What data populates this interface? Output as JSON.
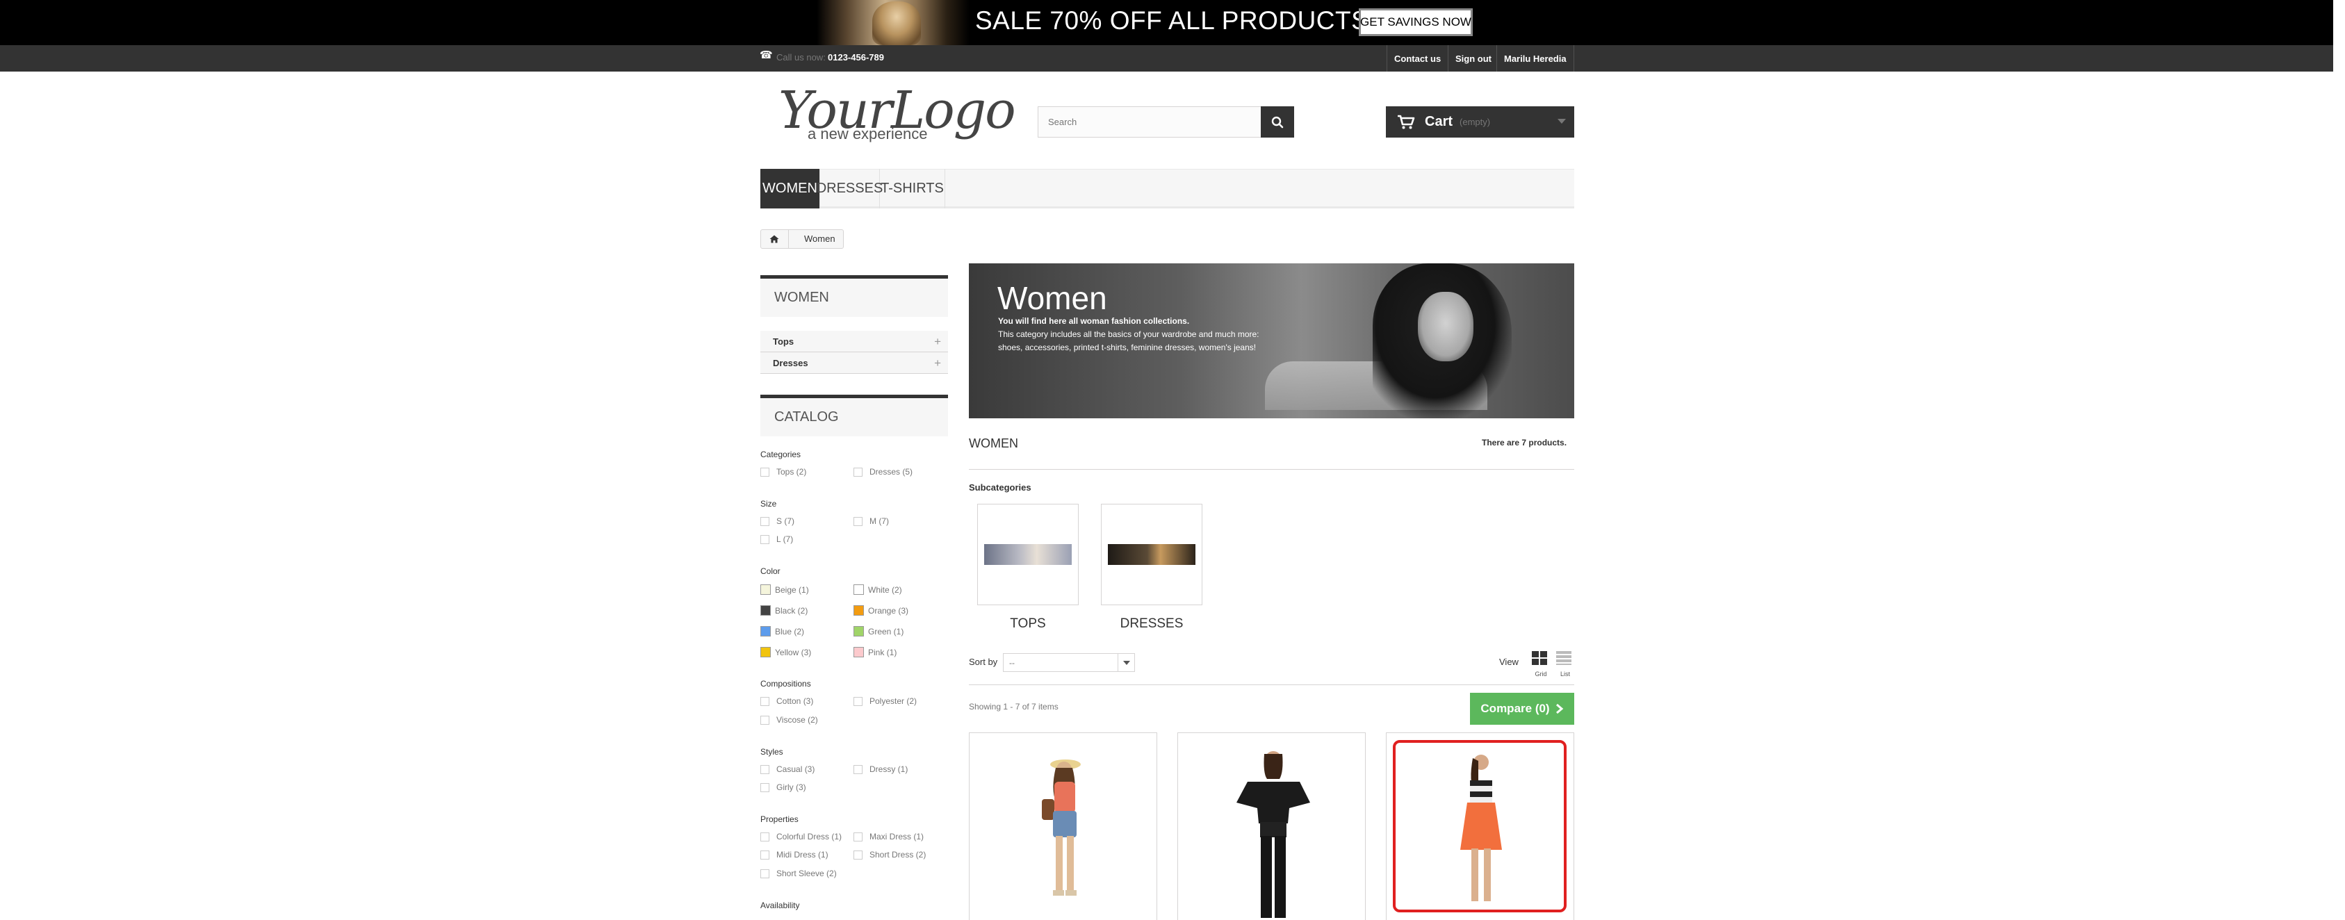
{
  "promo": {
    "text": "SALE 70% OFF ALL PRODUCTS",
    "button": "GET SAVINGS NOW"
  },
  "topnav": {
    "call_label": "Call us now:",
    "phone": "0123-456-789",
    "links": [
      "Contact us",
      "Sign out",
      "Marilu Heredia"
    ]
  },
  "header": {
    "logo": "YourLogo",
    "logo_tagline": "a new experience",
    "search_placeholder": "Search",
    "cart_label": "Cart",
    "cart_status": "(empty)"
  },
  "menu": [
    "WOMEN",
    "DRESSES",
    "T-SHIRTS"
  ],
  "breadcrumb": {
    "current": "Women"
  },
  "sidebar": {
    "women_title": "WOMEN",
    "subcategories": [
      "Tops",
      "Dresses"
    ],
    "catalog_title": "CATALOG",
    "filters": {
      "categories": {
        "title": "Categories",
        "options": [
          "Tops (2)",
          "Dresses (5)"
        ]
      },
      "size": {
        "title": "Size",
        "options": [
          "S (7)",
          "M (7)",
          "L (7)"
        ]
      },
      "color": {
        "title": "Color",
        "options": [
          {
            "label": "Beige (1)",
            "hex": "#f5f5dc"
          },
          {
            "label": "White (2)",
            "hex": "#ffffff"
          },
          {
            "label": "Black (2)",
            "hex": "#434343"
          },
          {
            "label": "Orange (3)",
            "hex": "#f39c11"
          },
          {
            "label": "Blue (2)",
            "hex": "#5d9cec"
          },
          {
            "label": "Green (1)",
            "hex": "#a0d468"
          },
          {
            "label": "Yellow (3)",
            "hex": "#f1c40f"
          },
          {
            "label": "Pink (1)",
            "hex": "#fccacd"
          }
        ]
      },
      "compositions": {
        "title": "Compositions",
        "options": [
          "Cotton (3)",
          "Polyester (2)",
          "Viscose (2)"
        ]
      },
      "styles": {
        "title": "Styles",
        "options": [
          "Casual (3)",
          "Dressy (1)",
          "Girly (3)"
        ]
      },
      "properties": {
        "title": "Properties",
        "options": [
          "Colorful Dress (1)",
          "Maxi Dress (1)",
          "Midi Dress (1)",
          "Short Dress (2)",
          "Short Sleeve (2)"
        ]
      },
      "availability": {
        "title": "Availability"
      }
    }
  },
  "category": {
    "banner_title": "Women",
    "banner_strong": "You will find here all woman fashion collections.",
    "banner_desc1": "This category includes all the basics of your wardrobe and much more:",
    "banner_desc2": "shoes, accessories, printed t-shirts, feminine dresses, women's jeans!",
    "heading": "WOMEN",
    "product_count": "There are 7 products.",
    "subcategories_label": "Subcategories",
    "subcategories": [
      "TOPS",
      "DRESSES"
    ],
    "sort_label": "Sort by",
    "sort_value": "--",
    "view_label": "View",
    "view_grid": "Grid",
    "view_list": "List",
    "showing": "Showing 1 - 7 of 7 items",
    "compare": "Compare (0)"
  },
  "colors": {
    "dark": "#333333",
    "compare_green": "#5cb85c",
    "highlight_red": "#e02020"
  }
}
